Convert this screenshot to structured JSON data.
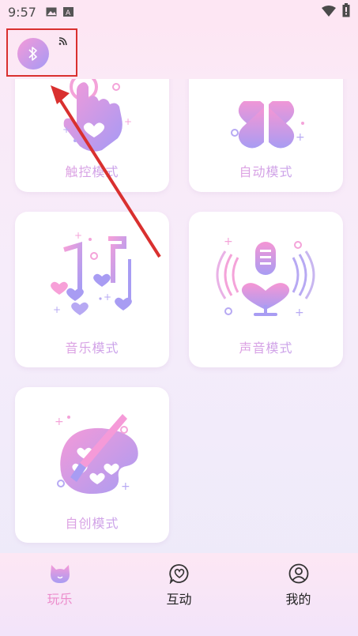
{
  "status_bar": {
    "time": "9:57",
    "icons": [
      "image-icon",
      "keyboard-a-icon",
      "wifi-icon",
      "battery-icon"
    ]
  },
  "header": {
    "bluetooth_icon": "bluetooth-icon",
    "signal_icon": "signal-icon"
  },
  "modes": [
    {
      "label": "触控模式",
      "icon": "touch-hand-icon"
    },
    {
      "label": "自动模式",
      "icon": "clover-icon"
    },
    {
      "label": "音乐模式",
      "icon": "music-notes-icon"
    },
    {
      "label": "声音模式",
      "icon": "microphone-heart-icon"
    },
    {
      "label": "自创模式",
      "icon": "palette-brush-icon"
    }
  ],
  "bottom_nav": [
    {
      "label": "玩乐",
      "icon": "cat-face-icon",
      "active": true
    },
    {
      "label": "互动",
      "icon": "heart-chat-icon",
      "active": false
    },
    {
      "label": "我的",
      "icon": "user-icon",
      "active": false
    }
  ],
  "colors": {
    "accent_pink": "#f59ad8",
    "accent_purple": "#a59af5",
    "annotation_red": "#d9302f",
    "text_dark": "#222222"
  }
}
